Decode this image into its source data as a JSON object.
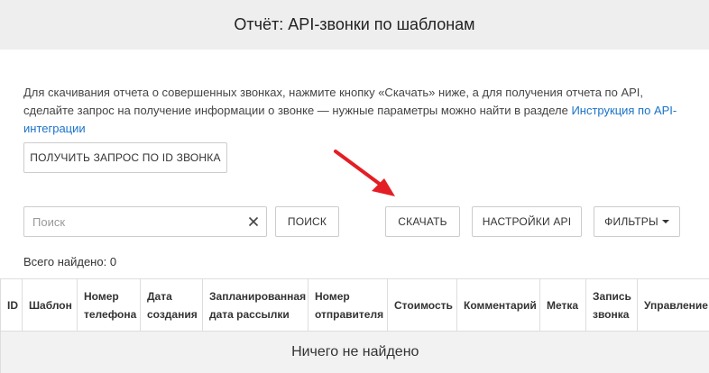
{
  "header": {
    "title": "Отчёт: API-звонки по шаблонам"
  },
  "description": {
    "text": "Для скачивания отчета о совершенных звонках, нажмите кнопку «Скачать» ниже, а для получения отчета по API, сделайте запрос на получение информации о звонке — нужные параметры можно найти в разделе ",
    "link": "Инструкция по API-интеграции"
  },
  "buttons": {
    "get_request": "ПОЛУЧИТЬ ЗАПРОС ПО ID ЗВОНКА",
    "search": "ПОИСК",
    "download": "СКАЧАТЬ",
    "api_settings": "НАСТРОЙКИ API",
    "filters": "ФИЛЬТРЫ"
  },
  "search": {
    "placeholder": "Поиск",
    "value": ""
  },
  "total_found": "Всего найдено: 0",
  "table": {
    "columns": [
      "ID",
      "Шаблон",
      "Номер телефона",
      "Дата создания",
      "Запланированная дата рассылки",
      "Номер отправителя",
      "Стоимость",
      "Комментарий",
      "Метка",
      "Запись звонка",
      "Управление"
    ],
    "empty_message": "Ничего не найдено"
  },
  "colors": {
    "accent_link": "#1a73c9",
    "annotation_arrow": "#e31e24",
    "header_bg": "#eeeeee"
  },
  "icons": {
    "clear": "close-icon",
    "filters_caret": "caret-down-icon",
    "annotation": "red-arrow"
  }
}
